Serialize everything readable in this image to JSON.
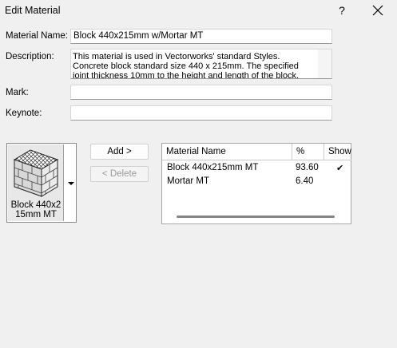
{
  "window": {
    "title": "Edit Material",
    "help_label": "?",
    "close_icon": "close-icon"
  },
  "form": {
    "name_label": "Material Name:",
    "name_value": "Block 440x215mm w/Mortar MT",
    "description_label": "Description:",
    "description_value": "This material is used in Vectorworks' standard Styles. Concrete block standard size 440 x 215mm. The specified joint thickness 10mm to the height and length of the block.",
    "mark_label": "Mark:",
    "mark_value": "",
    "keynote_label": "Keynote:",
    "keynote_value": ""
  },
  "swatch": {
    "label": "Block 440x2 15mm MT",
    "icon": "block-material-icon",
    "dropdown_icon": "dropdown-arrow-icon"
  },
  "buttons": {
    "add": "Add >",
    "delete": "< Delete"
  },
  "components": {
    "headers": [
      "Material Name",
      "%",
      "Show"
    ],
    "rows": [
      {
        "name": "Block 440x215mm MT",
        "percent": "93.60",
        "show": "✔"
      },
      {
        "name": "Mortar MT",
        "percent": "6.40",
        "show": ""
      }
    ]
  },
  "colors": {
    "background": "#f0f0f0",
    "field": "#ffffff",
    "disabled_text": "#9a9a9a"
  }
}
